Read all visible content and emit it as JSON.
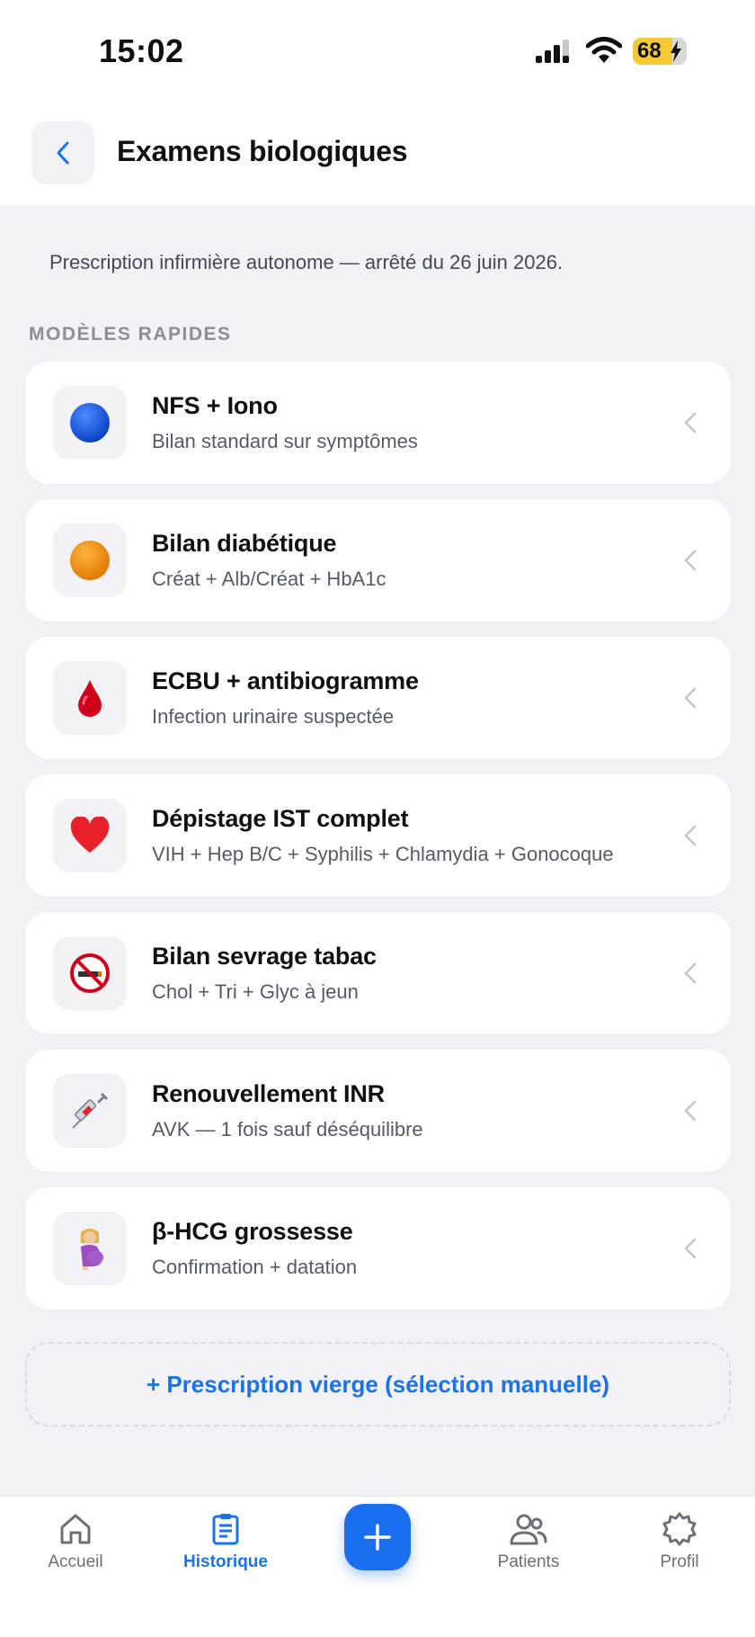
{
  "status": {
    "time": "15:02",
    "battery": "68"
  },
  "header": {
    "title": "Examens biologiques"
  },
  "subtitle": "Prescription infirmière autonome — arrêté du 26 juin 2026.",
  "section_label": "MODÈLES RAPIDES",
  "templates": [
    {
      "icon": "blue-circle-icon",
      "title": "NFS + Iono",
      "subtitle": "Bilan standard sur symptômes"
    },
    {
      "icon": "orange-circle-icon",
      "title": "Bilan diabétique",
      "subtitle": "Créat + Alb/Créat + HbA1c"
    },
    {
      "icon": "blood-drop-icon",
      "title": "ECBU + antibiogramme",
      "subtitle": "Infection urinaire suspectée"
    },
    {
      "icon": "heart-icon",
      "title": "Dépistage IST complet",
      "subtitle": "VIH + Hep B/C + Syphilis + Chlamydia + Gonocoque"
    },
    {
      "icon": "no-smoking-icon",
      "title": "Bilan sevrage tabac",
      "subtitle": "Chol + Tri + Glyc à jeun"
    },
    {
      "icon": "syringe-icon",
      "title": "Renouvellement INR",
      "subtitle": "AVK — 1 fois sauf déséquilibre"
    },
    {
      "icon": "pregnant-woman-icon",
      "title": "β-HCG grossesse",
      "subtitle": "Confirmation + datation"
    }
  ],
  "blank_prescription_label": "+ Prescription vierge (sélection manuelle)",
  "tabs": [
    {
      "label": "Accueil",
      "icon": "home-icon"
    },
    {
      "label": "Historique",
      "icon": "clipboard-icon",
      "active": true
    },
    {
      "label": "Patients",
      "icon": "users-icon"
    },
    {
      "label": "Profil",
      "icon": "gear-icon"
    }
  ],
  "colors": {
    "accent": "#1a73e8",
    "background": "#f1f1f6",
    "battery": "#f6c935"
  }
}
